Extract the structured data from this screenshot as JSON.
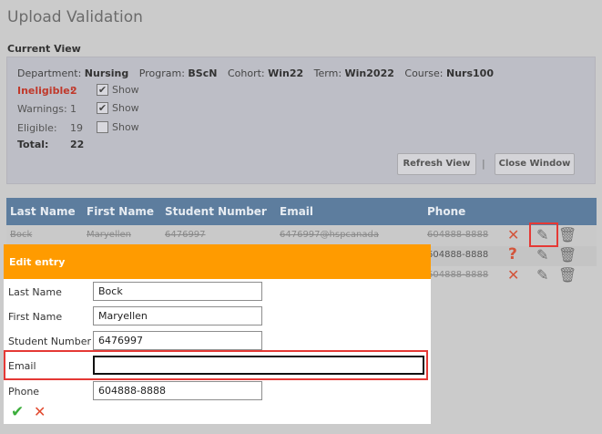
{
  "page": {
    "title": "Upload Validation"
  },
  "current_view": {
    "section_title": "Current View",
    "department_label": "Department:",
    "department": "Nursing",
    "program_label": "Program:",
    "program": "BScN",
    "cohort_label": "Cohort:",
    "cohort": "Win22",
    "term_label": "Term:",
    "term": "Win2022",
    "course_label": "Course:",
    "course": "Nurs100",
    "ineligible_label": "Ineligible:",
    "ineligible_count": "2",
    "ineligible_show": "Show",
    "warnings_label": "Warnings:",
    "warnings_count": "1",
    "warnings_show": "Show",
    "eligible_label": "Eligible:",
    "eligible_count": "19",
    "eligible_show": "Show",
    "total_label": "Total:",
    "total_count": "22",
    "refresh_label": "Refresh View",
    "separator": "|",
    "close_label": "Close Window"
  },
  "table": {
    "columns": [
      "Last Name",
      "First Name",
      "Student Number",
      "Email",
      "Phone"
    ],
    "rows": [
      {
        "last": "Bock",
        "first": "Maryellen",
        "number": "6476997",
        "email": "6476997@hspcanada",
        "phone": "604888-8888",
        "status": "x"
      },
      {
        "phone": "604888-8888",
        "status": "?"
      },
      {
        "phone": "604888-8888",
        "status": "x"
      }
    ]
  },
  "edit": {
    "title": "Edit entry",
    "last_name_label": "Last Name",
    "last_name": "Bock",
    "first_name_label": "First Name",
    "first_name": "Maryellen",
    "student_number_label": "Student Number",
    "student_number": "6476997",
    "email_label": "Email",
    "email": "",
    "phone_label": "Phone",
    "phone": "604888-8888"
  },
  "icons": {
    "checkmark": "✔",
    "close": "✕",
    "question": "?",
    "pencil": "✎",
    "trash": "🗑",
    "save": "✔",
    "cancel": "✕"
  },
  "colors": {
    "header_bg": "#5d7d9e",
    "edit_header_bg": "#ff9b00",
    "ineligible": "#c0392b",
    "highlight": "#e53935"
  }
}
